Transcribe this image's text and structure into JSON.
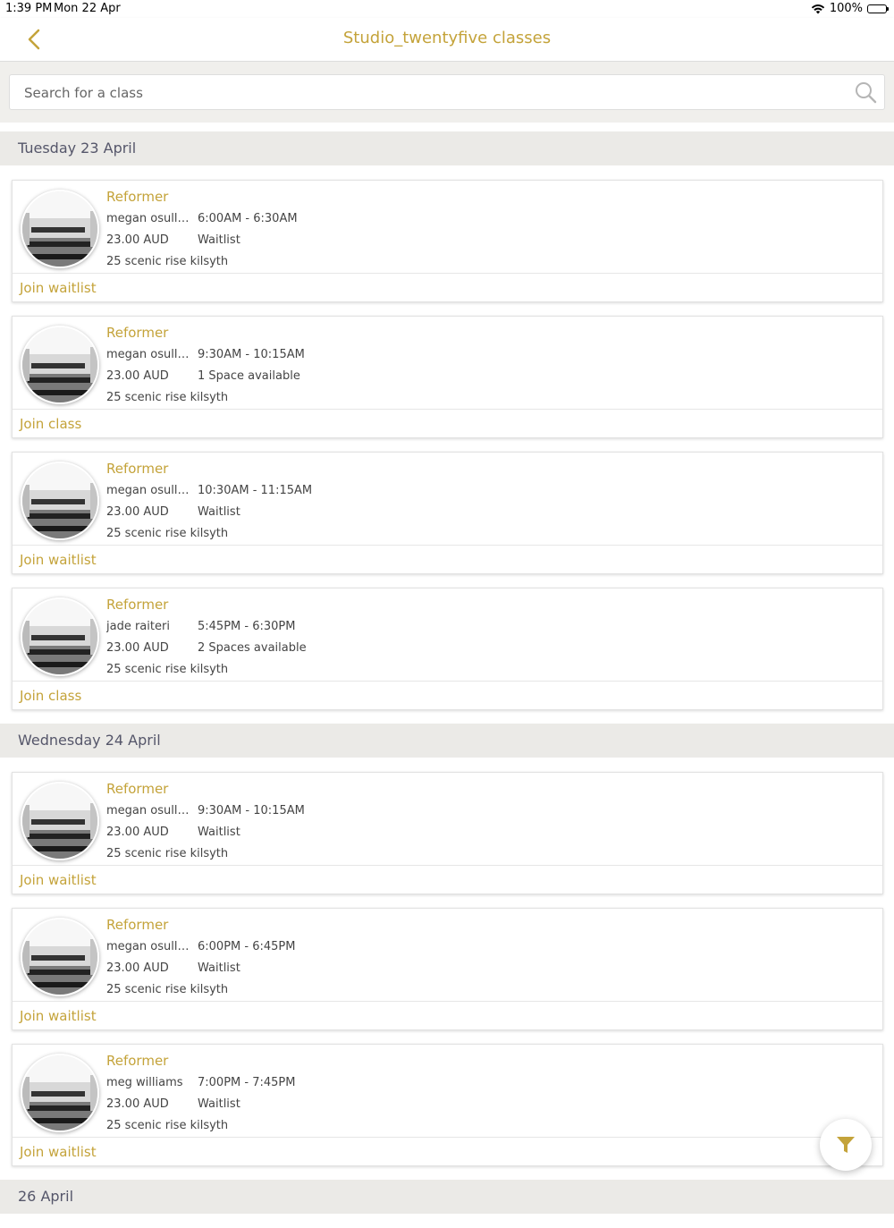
{
  "status_bar": {
    "time": "1:39 PM",
    "date": "Mon 22 Apr",
    "battery": "100%"
  },
  "nav": {
    "title": "Studio_twentyfive classes"
  },
  "search": {
    "placeholder": "Search for a class"
  },
  "colors": {
    "accent": "#c4a33a",
    "day_header_bg": "#ebeae7",
    "day_header_text": "#55566a"
  },
  "days": [
    {
      "label": "Tuesday 23 April",
      "classes": [
        {
          "name": "Reformer",
          "instructor": "megan osullivan",
          "time": "6:00AM - 6:30AM",
          "price": "23.00 AUD",
          "availability": "Waitlist",
          "location": "25 scenic rise kilsyth",
          "action": "Join waitlist"
        },
        {
          "name": "Reformer",
          "instructor": "megan osullivan",
          "time": "9:30AM - 10:15AM",
          "price": "23.00 AUD",
          "availability": "1 Space available",
          "location": "25 scenic rise kilsyth",
          "action": "Join class"
        },
        {
          "name": "Reformer",
          "instructor": "megan osullivan",
          "time": "10:30AM - 11:15AM",
          "price": "23.00 AUD",
          "availability": "Waitlist",
          "location": "25 scenic rise kilsyth",
          "action": "Join waitlist"
        },
        {
          "name": "Reformer",
          "instructor": "jade raiteri",
          "time": "5:45PM - 6:30PM",
          "price": "23.00 AUD",
          "availability": "2 Spaces available",
          "location": "25 scenic rise kilsyth",
          "action": "Join class"
        }
      ]
    },
    {
      "label": "Wednesday 24 April",
      "classes": [
        {
          "name": "Reformer",
          "instructor": "megan osullivan",
          "time": "9:30AM - 10:15AM",
          "price": "23.00 AUD",
          "availability": "Waitlist",
          "location": "25 scenic rise kilsyth",
          "action": "Join waitlist"
        },
        {
          "name": "Reformer",
          "instructor": "megan osullivan",
          "time": "6:00PM - 6:45PM",
          "price": "23.00 AUD",
          "availability": "Waitlist",
          "location": "25 scenic rise kilsyth",
          "action": "Join waitlist"
        },
        {
          "name": "Reformer",
          "instructor": "meg williams",
          "time": "7:00PM - 7:45PM",
          "price": "23.00 AUD",
          "availability": "Waitlist",
          "location": "25 scenic rise kilsyth",
          "action": "Join waitlist"
        }
      ]
    },
    {
      "label": "26 April",
      "classes": []
    }
  ],
  "icons": {
    "back": "chevron-left-icon",
    "search": "search-icon",
    "filter": "filter-icon",
    "wifi": "wifi-icon",
    "battery": "battery-icon"
  }
}
